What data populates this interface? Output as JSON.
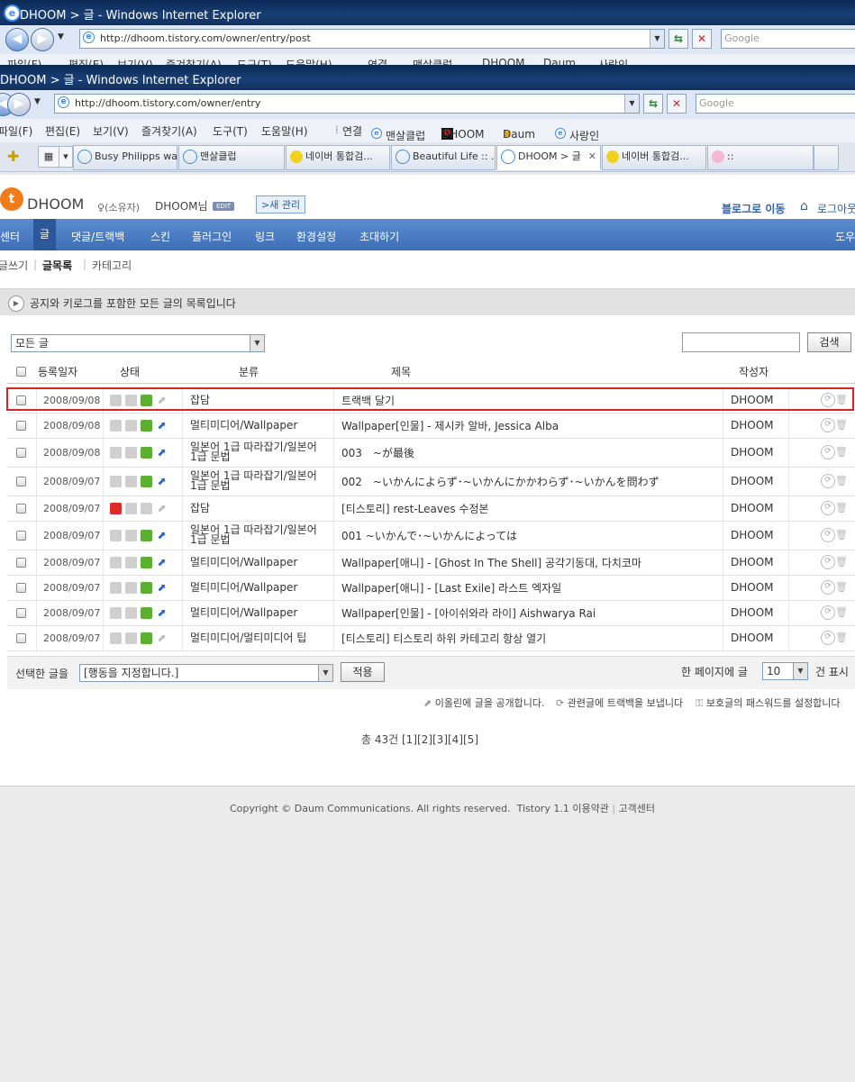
{
  "back_window": {
    "title": "DHOOM > 글 - Windows Internet Explorer",
    "url": "http://dhoom.tistory.com/owner/entry/post",
    "search_placeholder": "Google",
    "menu_partial": [
      "파일(F)",
      "편집(E)",
      "보기(V)",
      "즐겨찾기(A)",
      "도구(T)",
      "도움말(H)",
      "연결",
      "맨살클럽",
      "DHOOM",
      "Daum",
      "사랑인"
    ]
  },
  "window": {
    "title": "DHOOM > 글 - Windows Internet Explorer",
    "url": "http://dhoom.tistory.com/owner/entry",
    "search_placeholder": "Google"
  },
  "menubar": {
    "items": [
      "파일(F)",
      "편집(E)",
      "보기(V)",
      "즐겨찾기(A)",
      "도구(T)",
      "도움말(H)"
    ],
    "links_label": "연결",
    "links": [
      "맨살클럽",
      "DHOOM",
      "Daum",
      "사랑인"
    ]
  },
  "tabs": [
    {
      "label": "Busy Philipps wa...",
      "active": false
    },
    {
      "label": "맨살클럽",
      "active": false
    },
    {
      "label": "네이버 통합검...",
      "active": false
    },
    {
      "label": "Beautiful Life :: ...",
      "active": false
    },
    {
      "label": "DHOOM > 글",
      "active": true
    },
    {
      "label": "네이버 통합검...",
      "active": false
    },
    {
      "label": "::",
      "active": false
    }
  ],
  "header": {
    "logo": "DHOOM",
    "owner": "(소유자)",
    "user": "DHOOM님",
    "edit": "EDIT",
    "new_admin": ">새 관리",
    "to_blog": "블로그로 이동",
    "login": "로그아웃"
  },
  "gnb": {
    "items": [
      "센터",
      "글",
      "댓글/트랙백",
      "스킨",
      "플러그인",
      "링크",
      "환경설정",
      "초대하기"
    ],
    "help": "도우"
  },
  "subnav": {
    "items": [
      "글쓰기",
      "글목록",
      "카테고리"
    ]
  },
  "notice": "공지와 키로그를 포함한 모든 글의 목록입니다",
  "filter": {
    "value": "모든 글",
    "search_label": "검색"
  },
  "table": {
    "headers": {
      "date": "등록일자",
      "status": "상태",
      "category": "분류",
      "title": "제목",
      "author": "작성자"
    },
    "rows": [
      {
        "date": "2008/09/08",
        "category": "잡담",
        "title": "트랙백 달기",
        "author": "DHOOM"
      },
      {
        "date": "2008/09/08",
        "category": "멀티미디어/Wallpaper",
        "title": "Wallpaper[인물] - 제시카 알바, Jessica Alba",
        "author": "DHOOM"
      },
      {
        "date": "2008/09/08",
        "category": "일본어 1급 따라잡기/일본어 1급 문법",
        "title": "003　~が最後",
        "author": "DHOOM"
      },
      {
        "date": "2008/09/07",
        "category": "일본어 1급 따라잡기/일본어 1급 문법",
        "title": "002　~いかんによらず･~いかんにかかわらず･~いかんを問わず",
        "author": "DHOOM"
      },
      {
        "date": "2008/09/07",
        "category": "잡담",
        "title": "[티스토리] rest-Leaves 수정본",
        "author": "DHOOM"
      },
      {
        "date": "2008/09/07",
        "category": "일본어 1급 따라잡기/일본어 1급 문법",
        "title": "001 ~いかんで･~いかんによっては",
        "author": "DHOOM"
      },
      {
        "date": "2008/09/07",
        "category": "멀티미디어/Wallpaper",
        "title": "Wallpaper[애니] - [Ghost In The Shell] 공각기동대, 다치코마",
        "author": "DHOOM"
      },
      {
        "date": "2008/09/07",
        "category": "멀티미디어/Wallpaper",
        "title": "Wallpaper[애니] - [Last Exile] 라스트 엑자일",
        "author": "DHOOM"
      },
      {
        "date": "2008/09/07",
        "category": "멀티미디어/Wallpaper",
        "title": "Wallpaper[인물] - [아이쉬와라 라이] Aishwarya Rai",
        "author": "DHOOM"
      },
      {
        "date": "2008/09/07",
        "category": "멀티미디어/멀티미디어 팁",
        "title": "[티스토리] 티스토리 하위 카테고리 항상 열기",
        "author": "DHOOM"
      }
    ]
  },
  "bulk": {
    "label": "선택한 글을",
    "select_value": "[행동을 지정합니다.]",
    "apply": "적용",
    "per_page_label": "한 페이지에 글",
    "per_page_value": "10",
    "per_page_suffix": "건 표시"
  },
  "legend": {
    "publish": "이올린에 글을 공개합니다.",
    "trackback": "관련글에 트랙백을 보냅니다",
    "password": "보호글의 패스워드를 설정합니다"
  },
  "pager": {
    "total": "총 43건",
    "pages": [
      "[1]",
      "[2]",
      "[3]",
      "[4]",
      "[5]"
    ]
  },
  "footer": {
    "copyright": "Copyright © Daum Communications. All rights reserved.",
    "version": "Tistory 1.1",
    "terms": "이용약관",
    "support": "고객센터"
  }
}
